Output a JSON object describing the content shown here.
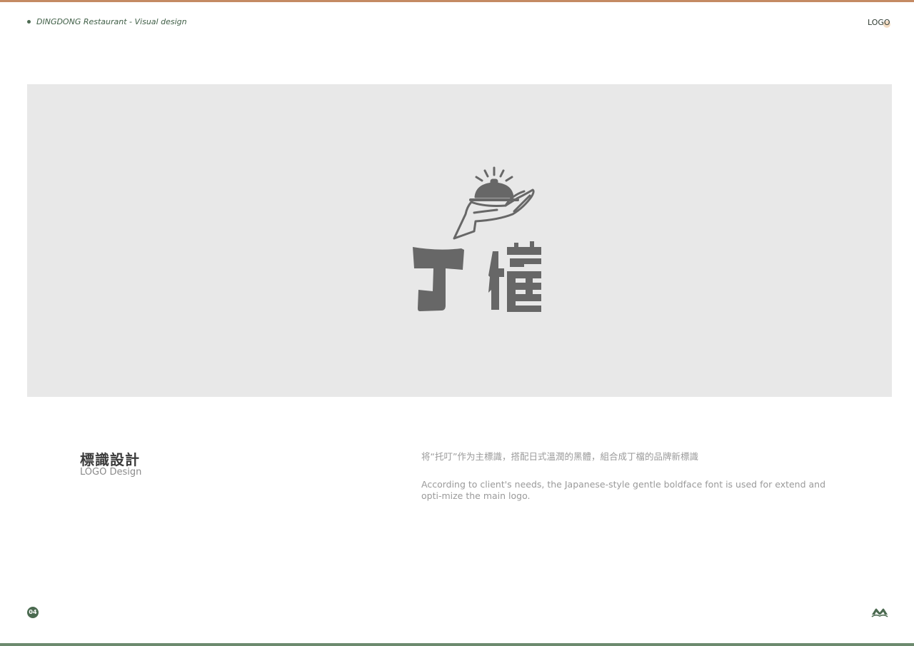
{
  "header": {
    "title": "DINGDONG Restaurant - Visual design",
    "section_tag": "LOGO"
  },
  "logo": {
    "wordmark": "丁檔",
    "icon": "hand-holding-service-bell-icon"
  },
  "content": {
    "heading_zh": "標識設計",
    "heading_en": "LOGO Design",
    "description_zh": "将“托叮”作为主標識，搭配日式溫潤的黑體，組合成丁檔的品牌新標識",
    "description_en": "According to client's needs, the Japanese-style gentle boldface font is used for extend and opti-mize the main logo."
  },
  "footer": {
    "page_number": "04",
    "brand_mark_icon": "mountain-brand-mark-icon"
  },
  "colors": {
    "top_rule": "#c48a63",
    "bottom_rule": "#6c8a6e",
    "accent_green": "#4b6a50",
    "logo_gray": "#676767",
    "panel_gray": "#e8e8e8"
  }
}
